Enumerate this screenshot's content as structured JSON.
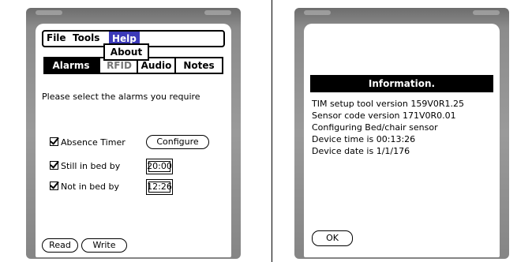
{
  "left_screen": {
    "menu": {
      "file": "File",
      "tools": "Tools",
      "help": "Help"
    },
    "help_dropdown": {
      "about": "About"
    },
    "tabs": [
      {
        "label": "Alarms",
        "active": true
      },
      {
        "label": "RFID",
        "active": false
      },
      {
        "label": "Audio",
        "active": false
      },
      {
        "label": "Notes",
        "active": false
      }
    ],
    "prompt": "Please select the alarms you require",
    "alarms": {
      "absence_timer": {
        "label": "Absence Timer",
        "checked": true,
        "button": "Configure"
      },
      "still_in_bed": {
        "label": "Still in bed by",
        "checked": true,
        "time": "20:00"
      },
      "not_in_bed": {
        "label": "Not in bed by",
        "checked": true,
        "time": "12:26"
      }
    },
    "buttons": {
      "read": "Read",
      "write": "Write"
    }
  },
  "right_screen": {
    "title": "Information.",
    "lines": [
      "TIM setup tool version 159V0R1.25",
      "Sensor code version 171V0R0.01",
      "Configuring Bed/chair sensor",
      "Device time is 00:13:26",
      "Device date is 1/1/176"
    ],
    "ok_button": "OK"
  },
  "colors": {
    "menu_highlight": "#3c3ab8",
    "bezel": "#8c8c8c",
    "screen": "#ffffff"
  }
}
